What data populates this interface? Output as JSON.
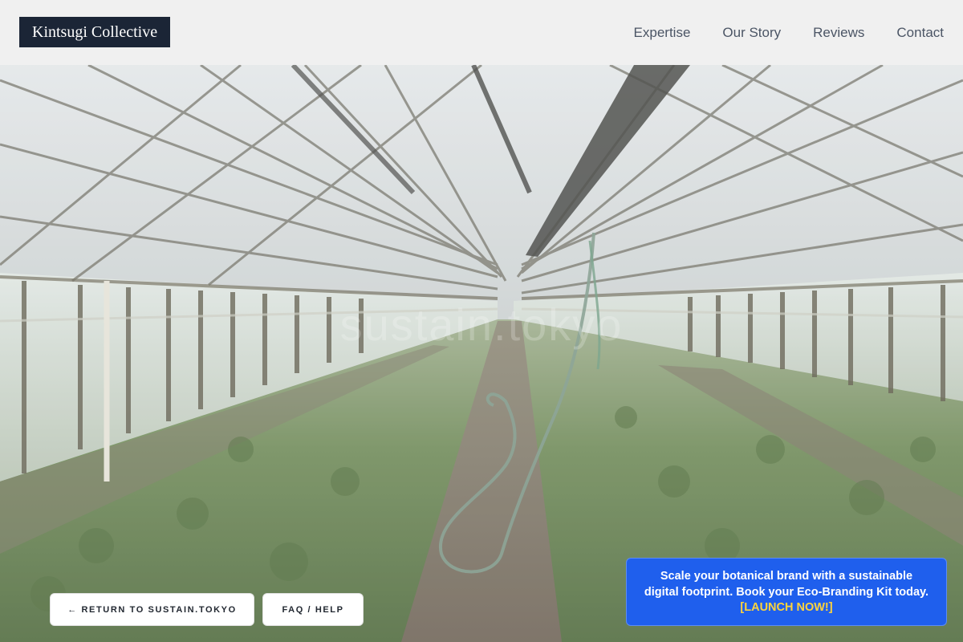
{
  "header": {
    "logo": "Kintsugi Collective",
    "nav": [
      {
        "label": "Expertise"
      },
      {
        "label": "Our Story"
      },
      {
        "label": "Reviews"
      },
      {
        "label": "Contact"
      }
    ]
  },
  "hero": {
    "watermark": "sustain.tokyo"
  },
  "actions": {
    "return_label": "← RETURN TO SUSTAIN.TOKYO",
    "faq_label": "FAQ / HELP"
  },
  "promo": {
    "text": "Scale your botanical brand with a sustainable digital footprint. Book your Eco-Branding Kit today.",
    "cta": "[LAUNCH NOW!]"
  },
  "colors": {
    "header_bg": "#f0f0f0",
    "logo_bg": "#1b2536",
    "promo_bg": "#1f5fed",
    "promo_cta": "#ffd43b"
  }
}
